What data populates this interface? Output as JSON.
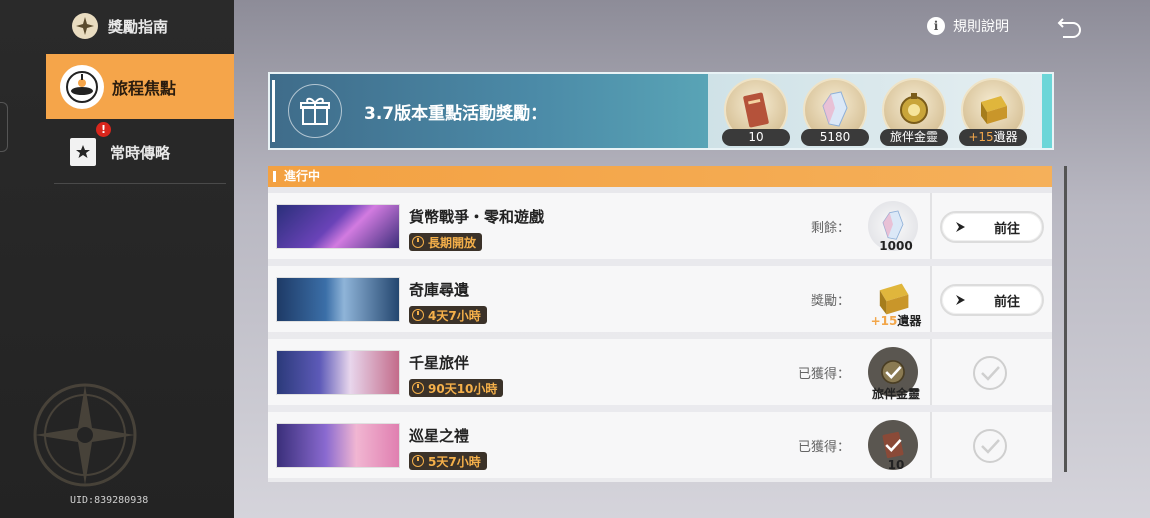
{
  "sidebar": {
    "header": "獎勵指南",
    "active_item": "旅程焦點",
    "item": "常時傳略",
    "badge": "!",
    "uid": "UID:839280938"
  },
  "topbar": {
    "rules_label": "規則說明"
  },
  "banner": {
    "title": "3.7版本重點活動獎勵：",
    "rewards": [
      {
        "icon": "ticket-icon",
        "label": "10"
      },
      {
        "icon": "crystal-icon",
        "label": "5180"
      },
      {
        "icon": "companion-spirit-icon",
        "label": "旅伴金靈"
      },
      {
        "icon": "relic-chest-icon",
        "label_plus": "+15",
        "label": "遺器"
      }
    ]
  },
  "list": {
    "header": "進行中",
    "rows": [
      {
        "title": "貨幣戰爭・零和遊戲",
        "timer": "長期開放",
        "status": "剩餘：",
        "reward_icon": "crystal-icon",
        "reward_caption": "1000",
        "action": "前往",
        "completed": false
      },
      {
        "title": "奇庫尋遺",
        "timer": "4天7小時",
        "status": "獎勵：",
        "reward_icon": "relic-chest-icon",
        "reward_plus": "+15",
        "reward_caption": "遺器",
        "action": "前往",
        "completed": false
      },
      {
        "title": "千星旅伴",
        "timer": "90天10小時",
        "status": "已獲得：",
        "reward_icon": "companion-spirit-icon",
        "reward_caption": "旅伴金靈",
        "completed": true
      },
      {
        "title": "巡星之禮",
        "timer": "5天7小時",
        "status": "已獲得：",
        "reward_icon": "ticket-icon",
        "reward_caption": "10",
        "completed": true
      }
    ]
  },
  "colors": {
    "accent": "#f5a54a",
    "sidebar_bg": "#262626",
    "banner_teal": "#4b8aa7",
    "timer_text": "#f5b04a"
  }
}
